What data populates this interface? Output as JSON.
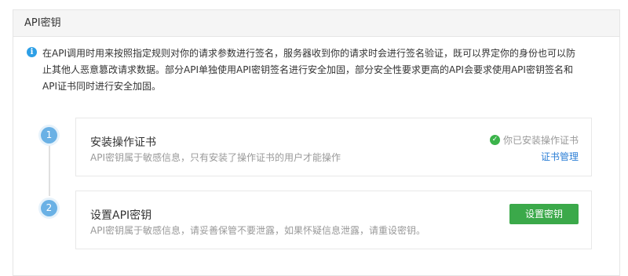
{
  "panel": {
    "title": "API密钥"
  },
  "notice": {
    "icon": "info-icon",
    "text": "在API调用时用来按照指定规则对你的请求参数进行签名，服务器收到你的请求时会进行签名验证，既可以界定你的身份也可以防止其他人恶意篡改请求数据。部分API单独使用API密钥签名进行安全加固，部分安全性要求更高的API会要求使用API密钥签名和API证书同时进行安全加固。"
  },
  "steps": [
    {
      "number": "1",
      "title": "安装操作证书",
      "desc": "API密钥属于敏感信息，只有安装了操作证书的用户才能操作",
      "status": "你已安装操作证书",
      "status_icon": "check-circle-icon",
      "link": "证书管理"
    },
    {
      "number": "2",
      "title": "设置API密钥",
      "desc": "API密钥属于敏感信息，请妥善保管不要泄露，如果怀疑信息泄露，请重设密钥。",
      "button": "设置密钥"
    }
  ],
  "colors": {
    "info_blue": "#2d9fe6",
    "step_blue": "#6ab1e5",
    "success_green": "#3bb34a",
    "button_green": "#3ba94a",
    "link_blue": "#2d7fd6"
  }
}
